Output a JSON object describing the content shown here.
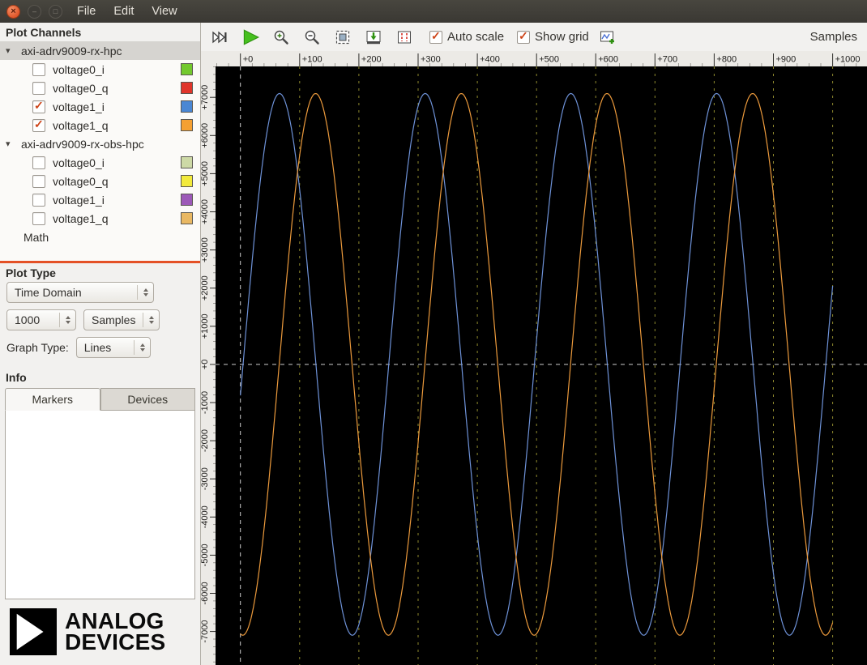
{
  "titlebar": {
    "menus": [
      "File",
      "Edit",
      "View"
    ]
  },
  "sidebar": {
    "plot_channels_label": "Plot Channels",
    "devices": [
      {
        "name": "axi-adrv9009-rx-hpc",
        "channels": [
          {
            "label": "voltage0_i",
            "checked": false,
            "color": "#73c92e"
          },
          {
            "label": "voltage0_q",
            "checked": false,
            "color": "#e0352b"
          },
          {
            "label": "voltage1_i",
            "checked": true,
            "color": "#4a87d4"
          },
          {
            "label": "voltage1_q",
            "checked": true,
            "color": "#f5a032"
          }
        ]
      },
      {
        "name": "axi-adrv9009-rx-obs-hpc",
        "channels": [
          {
            "label": "voltage0_i",
            "checked": false,
            "color": "#cdd9a6"
          },
          {
            "label": "voltage0_q",
            "checked": false,
            "color": "#f2ea3c"
          },
          {
            "label": "voltage1_i",
            "checked": false,
            "color": "#9c59b8"
          },
          {
            "label": "voltage1_q",
            "checked": false,
            "color": "#e9b863"
          }
        ]
      }
    ],
    "math_label": "Math",
    "plot_type_label": "Plot Type",
    "plot_type_value": "Time Domain",
    "sample_count_value": "1000",
    "sample_unit_value": "Samples",
    "graph_type_label": "Graph Type:",
    "graph_type_value": "Lines",
    "info_label": "Info",
    "tabs": [
      {
        "label": "Markers"
      },
      {
        "label": "Devices"
      }
    ],
    "logo": {
      "line1": "ANALOG",
      "line2": "DEVICES"
    }
  },
  "toolbar": {
    "icons": [
      "skip-to-end",
      "play",
      "zoom-in",
      "zoom-out",
      "zoom-fit",
      "capture-plot",
      "markers",
      "new-plot"
    ],
    "auto_scale": {
      "label": "Auto scale",
      "checked": true
    },
    "show_grid": {
      "label": "Show grid",
      "checked": true
    },
    "samples_label": "Samples"
  },
  "chart_data": {
    "type": "line",
    "xlabel": "Samples",
    "background": "#000000",
    "sample_count": 1000,
    "x_visible_range": [
      -42,
      1058
    ],
    "y_visible_range": [
      -7880,
      7810
    ],
    "x_major_ticks": [
      0,
      100,
      200,
      300,
      400,
      500,
      600,
      700,
      800,
      900,
      1000
    ],
    "y_major_ticks": [
      -7000,
      -6000,
      -5000,
      -4000,
      -3000,
      -2000,
      -1000,
      0,
      1000,
      2000,
      3000,
      4000,
      5000,
      6000,
      7000
    ],
    "grid": {
      "show": true,
      "vline_color": "#b3ad3a",
      "crosshair_color": "#f2f2f2"
    },
    "series": [
      {
        "name": "voltage1_i",
        "device": "axi-adrv9009-rx-hpc",
        "color": "#6e92d8",
        "waveform": "sine",
        "amplitude": 7100,
        "period_samples": 246,
        "peak_at_sample": 66
      },
      {
        "name": "voltage1_q",
        "device": "axi-adrv9009-rx-hpc",
        "color": "#ec9a3c",
        "waveform": "sine",
        "amplitude": 7100,
        "period_samples": 246,
        "peak_at_sample": 127
      }
    ]
  }
}
